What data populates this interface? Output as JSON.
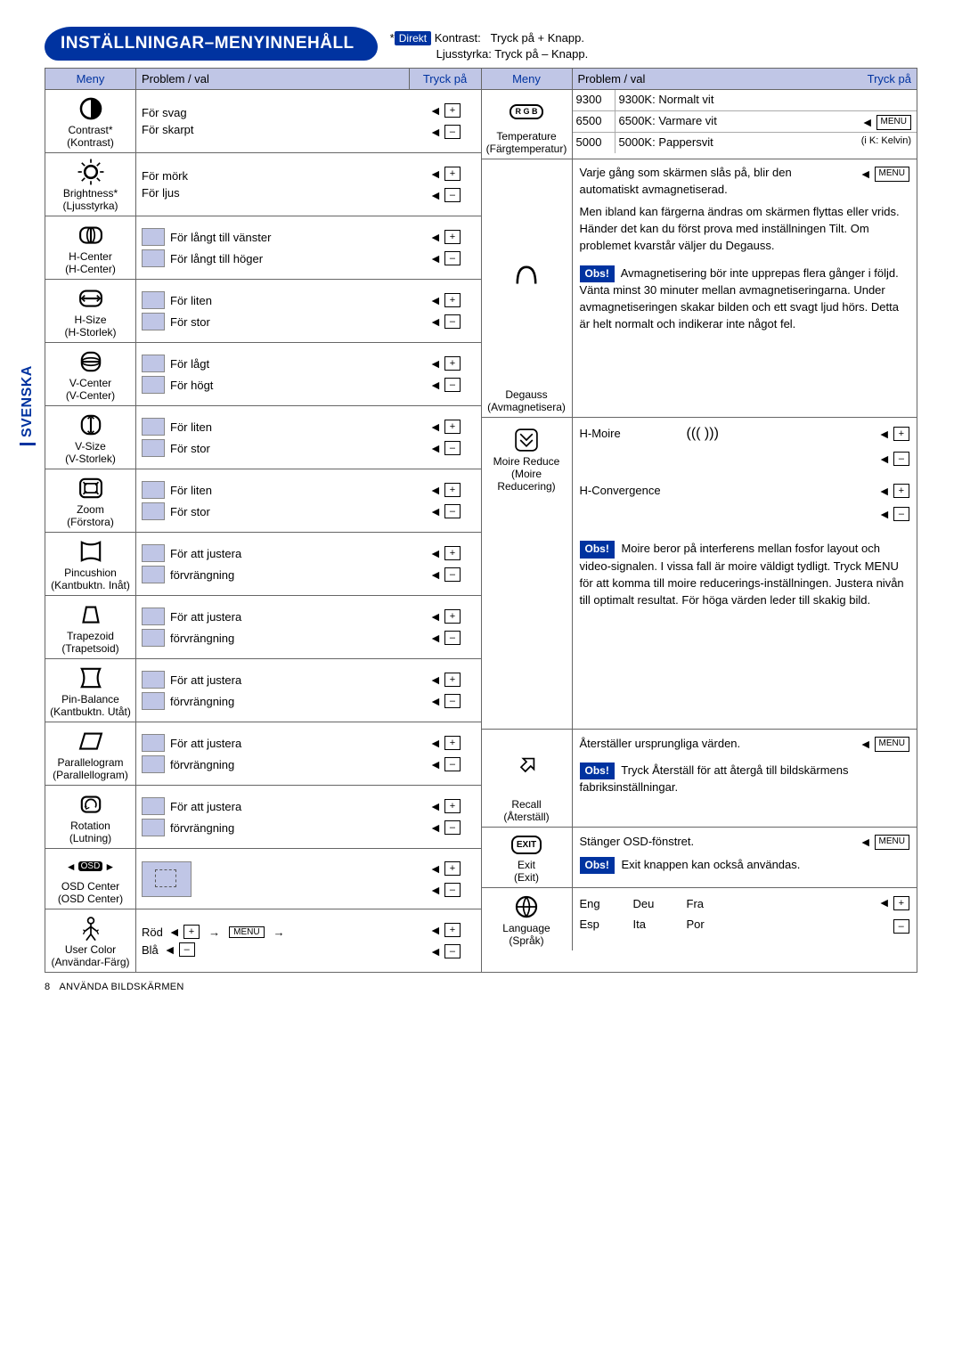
{
  "title": "INSTÄLLNINGAR–MENYINNEHÅLL",
  "direkt": {
    "badge": "Direkt",
    "line1a": "Kontrast:",
    "line1b": "Tryck på + Knapp.",
    "line2a": "Ljusstyrka:",
    "line2b": "Tryck på – Knapp."
  },
  "side_tab": "SVENSKA",
  "headers": {
    "meny": "Meny",
    "problem": "Problem / val",
    "tryck": "Tryck på"
  },
  "left": [
    {
      "en": "Contrast*",
      "sv": "(Kontrast)",
      "r1": "För svag",
      "r2": "För skarpt",
      "no_thumb": true
    },
    {
      "en": "Brightness*",
      "sv": "(Ljusstyrka)",
      "r1": "För mörk",
      "r2": "För ljus",
      "no_thumb": true
    },
    {
      "en": "H-Center",
      "sv": "(H-Center)",
      "r1": "För långt till vänster",
      "r2": "För långt till höger"
    },
    {
      "en": "H-Size",
      "sv": "(H-Storlek)",
      "r1": "För liten",
      "r2": "För stor"
    },
    {
      "en": "V-Center",
      "sv": "(V-Center)",
      "r1": "För lågt",
      "r2": "För högt"
    },
    {
      "en": "V-Size",
      "sv": "(V-Storlek)",
      "r1": "För liten",
      "r2": "För stor"
    },
    {
      "en": "Zoom",
      "sv": "(Förstora)",
      "r1": "För liten",
      "r2": "För stor"
    },
    {
      "en": "Pincushion",
      "sv": "(Kantbuktn. Inåt)",
      "r1": "För att justera",
      "r2": "förvrängning"
    },
    {
      "en": "Trapezoid",
      "sv": "(Trapetsoid)",
      "r1": "För att justera",
      "r2": "förvrängning"
    },
    {
      "en": "Pin-Balance",
      "sv": "(Kantbuktn. Utåt)",
      "r1": "För att justera",
      "r2": "förvrängning"
    },
    {
      "en": "Parallelogram",
      "sv": "(Parallellogram)",
      "r1": "För att justera",
      "r2": "förvrängning"
    },
    {
      "en": "Rotation",
      "sv": "(Lutning)",
      "r1": "För att justera",
      "r2": "förvrängning"
    },
    {
      "en": "OSD Center",
      "sv": "(OSD Center)",
      "r1": "",
      "r2": ""
    },
    {
      "en": "User Color",
      "sv": "(Användar-Färg)",
      "r1": "Röd",
      "r2": "Blå"
    }
  ],
  "right_menu": {
    "temp": {
      "en": "Temperature",
      "sv": "(Färgtemperatur)"
    },
    "degauss": {
      "en": "Degauss",
      "sv": "(Avmagnetisera)"
    },
    "moire": {
      "en": "Moire Reduce",
      "sv": "(Moire Reducering)"
    },
    "recall": {
      "en": "Recall",
      "sv": "(Återställ)"
    },
    "exit": {
      "en": "Exit",
      "sv": "(Exit)"
    },
    "lang": {
      "en": "Language",
      "sv": "(Språk)"
    }
  },
  "temp_rows": [
    {
      "k": "9300",
      "d": "9300K: Normalt vit"
    },
    {
      "k": "6500",
      "d": "6500K: Varmare vit"
    },
    {
      "k": "5000",
      "d": "5000K: Pappersvit"
    }
  ],
  "temp_note": "(i K: Kelvin)",
  "degauss_text1": "Varje gång som skärmen slås på, blir den automatiskt avmagnetiserad.",
  "degauss_text2": "Men ibland kan färgerna ändras om skärmen flyttas eller vrids. Händer det kan du först prova med inställningen Tilt.  Om problemet kvarstår väljer du Degauss.",
  "degauss_obs": "Avmagnetisering bör inte upprepas flera gånger i följd. Vänta minst 30 minuter mellan avmagnetiseringarna. Under avmagnetiseringen skakar bilden och ett svagt ljud hörs. Detta är helt normalt och indikerar inte något fel.",
  "moire_labels": {
    "h_moire": "H-Moire",
    "h_conv": "H-Convergence"
  },
  "moire_obs": "Moire beror på interferens mellan fosfor layout och video-signalen. I vissa fall är moire väldigt tydligt. Tryck MENU för att komma till  moire reducerings-inställningen. Justera nivån till optimalt resultat. För höga värden leder till skakig bild.",
  "recall_text": "Återställer ursprungliga värden.",
  "recall_obs": "Tryck Återställ för att återgå till bildskärmens fabriksinställningar.",
  "exit_text": "Stänger OSD-fönstret.",
  "exit_obs": "Exit knappen kan också användas.",
  "langs": [
    "Eng",
    "Deu",
    "Fra",
    "Esp",
    "Ita",
    "Por"
  ],
  "obs_label": "Obs!",
  "menu_label": "MENU",
  "exit_key": "EXIT",
  "footer": "ANVÄNDA BILDSKÄRMEN",
  "page_num": "8",
  "osd_label": "OSD",
  "rgb_label": "R G B"
}
